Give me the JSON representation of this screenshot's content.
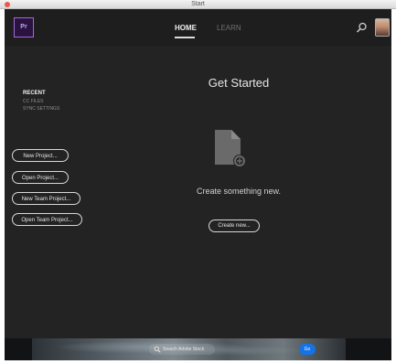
{
  "window": {
    "title": "Start"
  },
  "header": {
    "logo_text": "Pr",
    "tabs": [
      {
        "label": "HOME",
        "active": true
      },
      {
        "label": "LEARN",
        "active": false
      }
    ]
  },
  "sidebar": {
    "recent_label": "RECENT",
    "links": [
      "CC FILES",
      "SYNC SETTINGS"
    ],
    "buttons": [
      "New Project...",
      "Open Project...",
      "New Team Project...",
      "Open Team Project..."
    ]
  },
  "main": {
    "heading": "Get Started",
    "create_text": "Create something new.",
    "create_button": "Create new..."
  },
  "footer": {
    "search_placeholder": "Search Adobe Stock",
    "go_label": "Go"
  },
  "colors": {
    "accent": "#1473e6",
    "logo_border": "#9c6ad6",
    "background": "#232323"
  }
}
